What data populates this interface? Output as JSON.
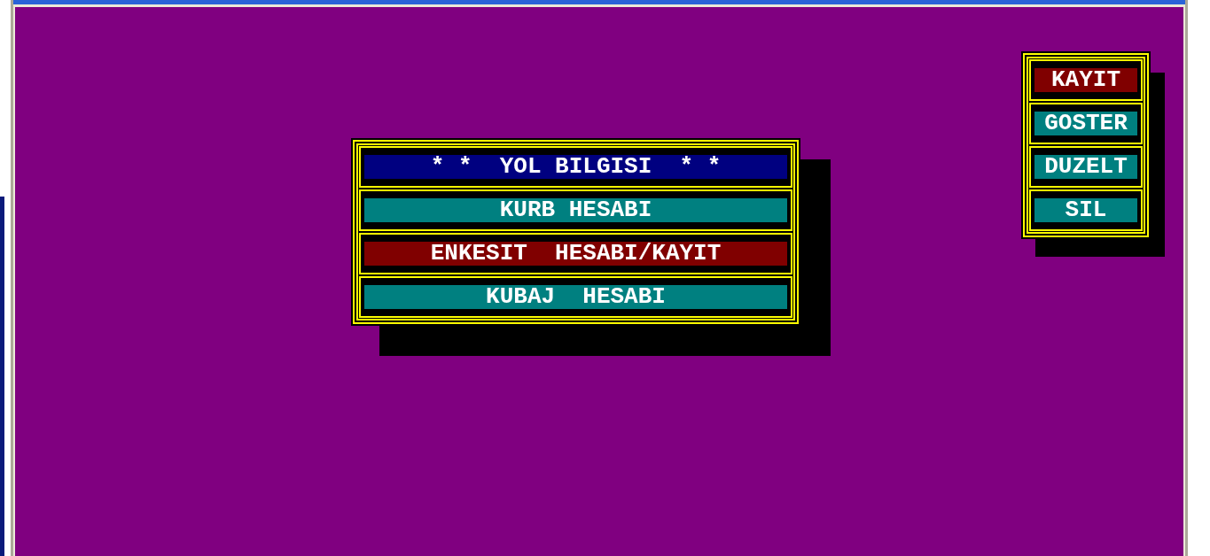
{
  "main_menu": {
    "items": [
      {
        "kind": "title",
        "label": "* *  YOL BILGISI  * *",
        "selected": false
      },
      {
        "kind": "option",
        "label": "KURB HESABI",
        "selected": false
      },
      {
        "kind": "option",
        "label": "ENKESIT  HESABI/KAYIT",
        "selected": true
      },
      {
        "kind": "option",
        "label": "KUBAJ  HESABI",
        "selected": false
      }
    ]
  },
  "action_menu": {
    "items": [
      {
        "label": "KAYIT",
        "selected": true
      },
      {
        "label": "GOSTER",
        "selected": false
      },
      {
        "label": "DUZELT",
        "selected": false
      },
      {
        "label": "SIL",
        "selected": false
      }
    ]
  }
}
